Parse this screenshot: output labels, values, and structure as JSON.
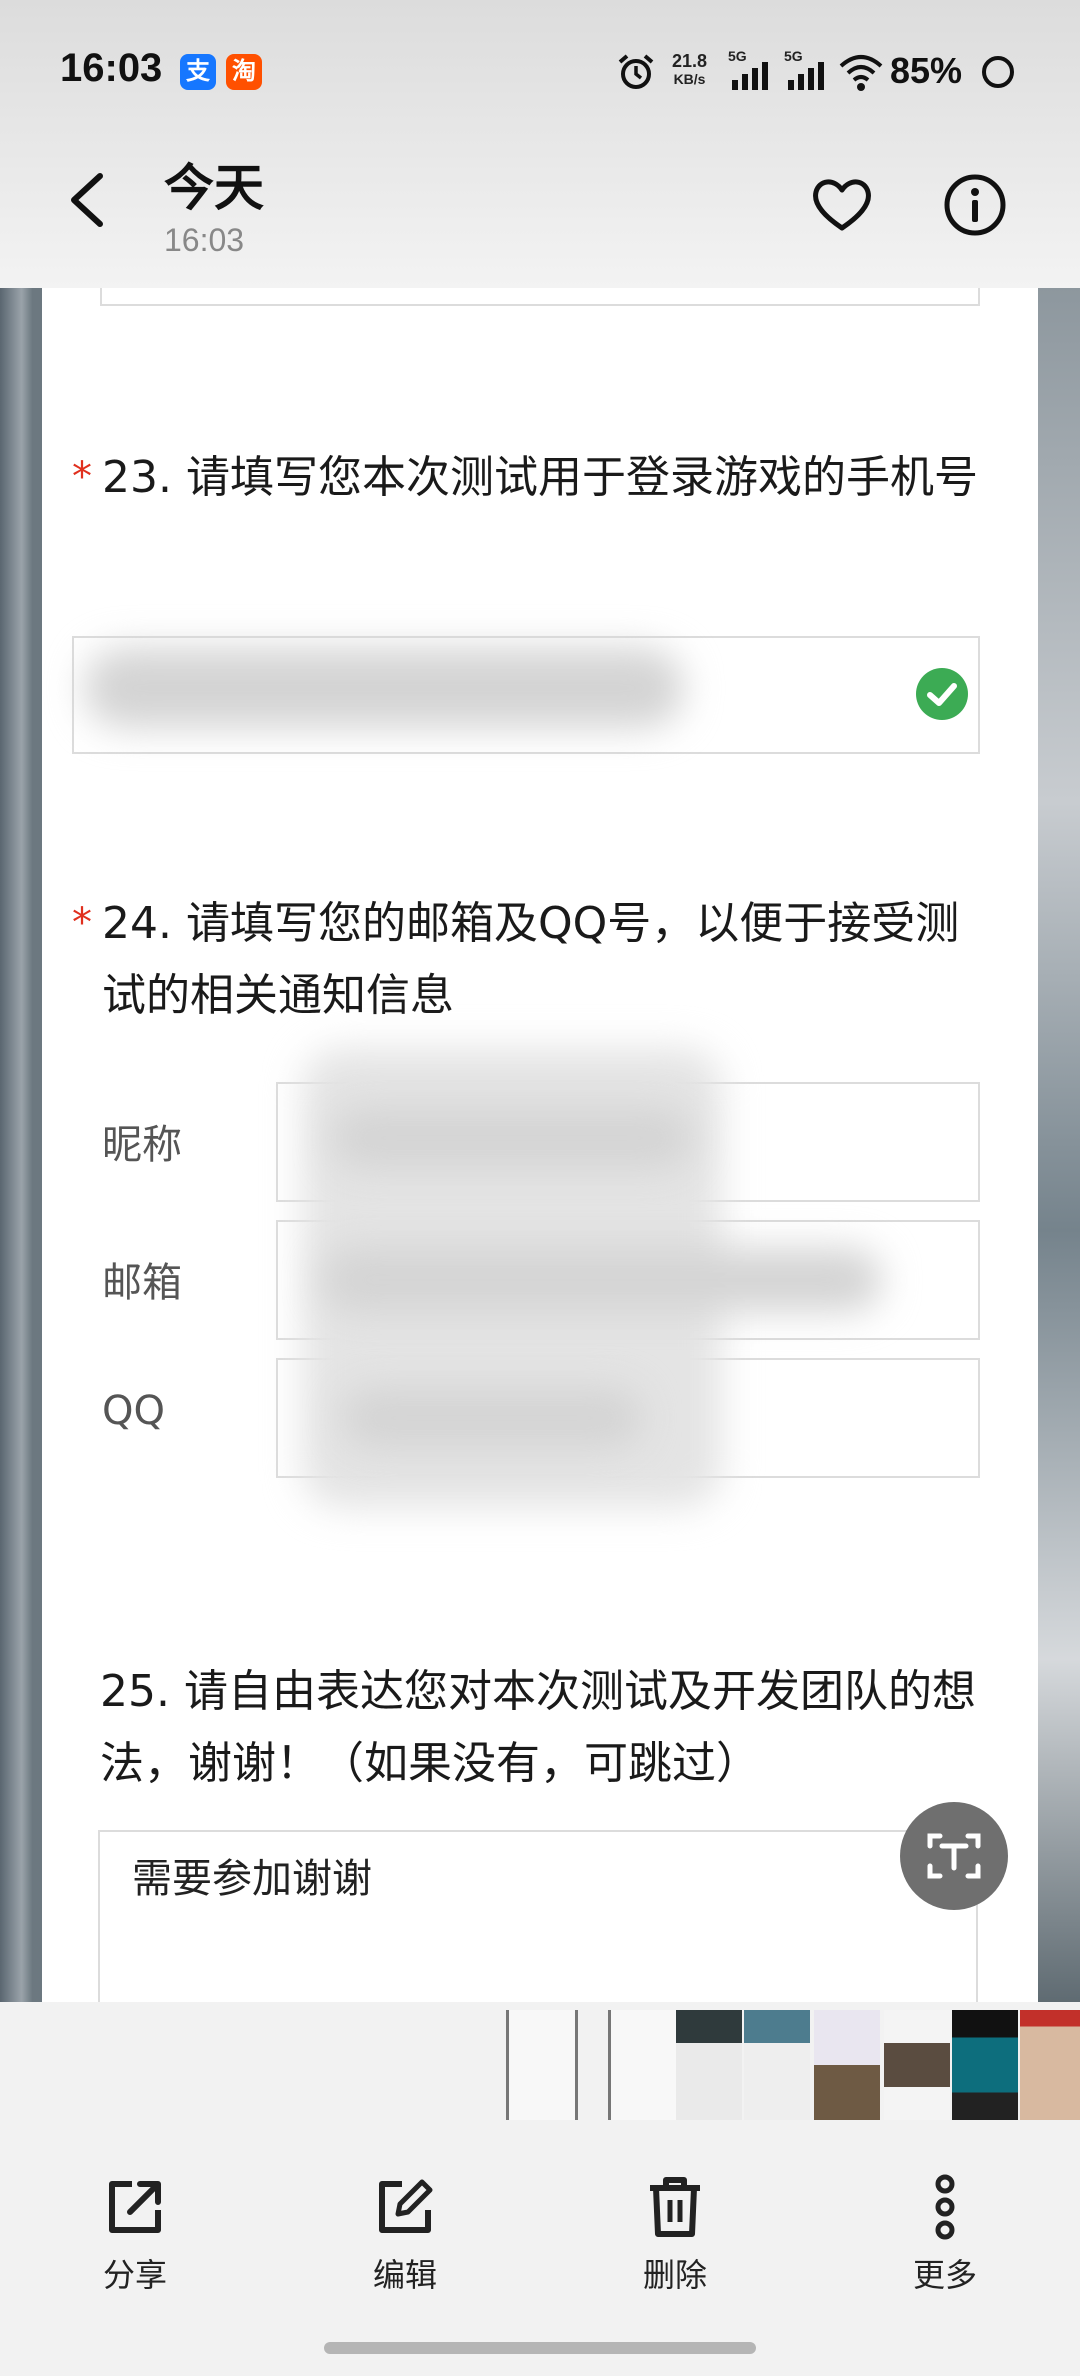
{
  "status_bar": {
    "time": "16:03",
    "app_icons": [
      "支",
      "淘"
    ],
    "net_speed_value": "21.8",
    "net_speed_unit": "KB/s",
    "signal_1": "5G",
    "signal_2": "5G",
    "battery": "85%"
  },
  "header": {
    "title": "今天",
    "subtitle": "16:03"
  },
  "form": {
    "q23_marker": "*",
    "q23": "23. 请填写您本次测试用于登录游戏的手机号",
    "q24_marker": "*",
    "q24": "24. 请填写您的邮箱及QQ号，以便于接受测试的相关通知信息",
    "field_labels": [
      "昵称",
      "邮箱",
      "QQ"
    ],
    "q25": "25. 请自由表达您对本次测试及开发团队的想法，谢谢！（如果没有，可跳过）",
    "q25_answer": "需要参加谢谢"
  },
  "actions": [
    {
      "label": "分享",
      "icon": "share-icon"
    },
    {
      "label": "编辑",
      "icon": "edit-icon"
    },
    {
      "label": "删除",
      "icon": "delete-icon"
    },
    {
      "label": "更多",
      "icon": "more-icon"
    }
  ],
  "colors": {
    "required": "#e0301e",
    "check": "#3cab54"
  }
}
